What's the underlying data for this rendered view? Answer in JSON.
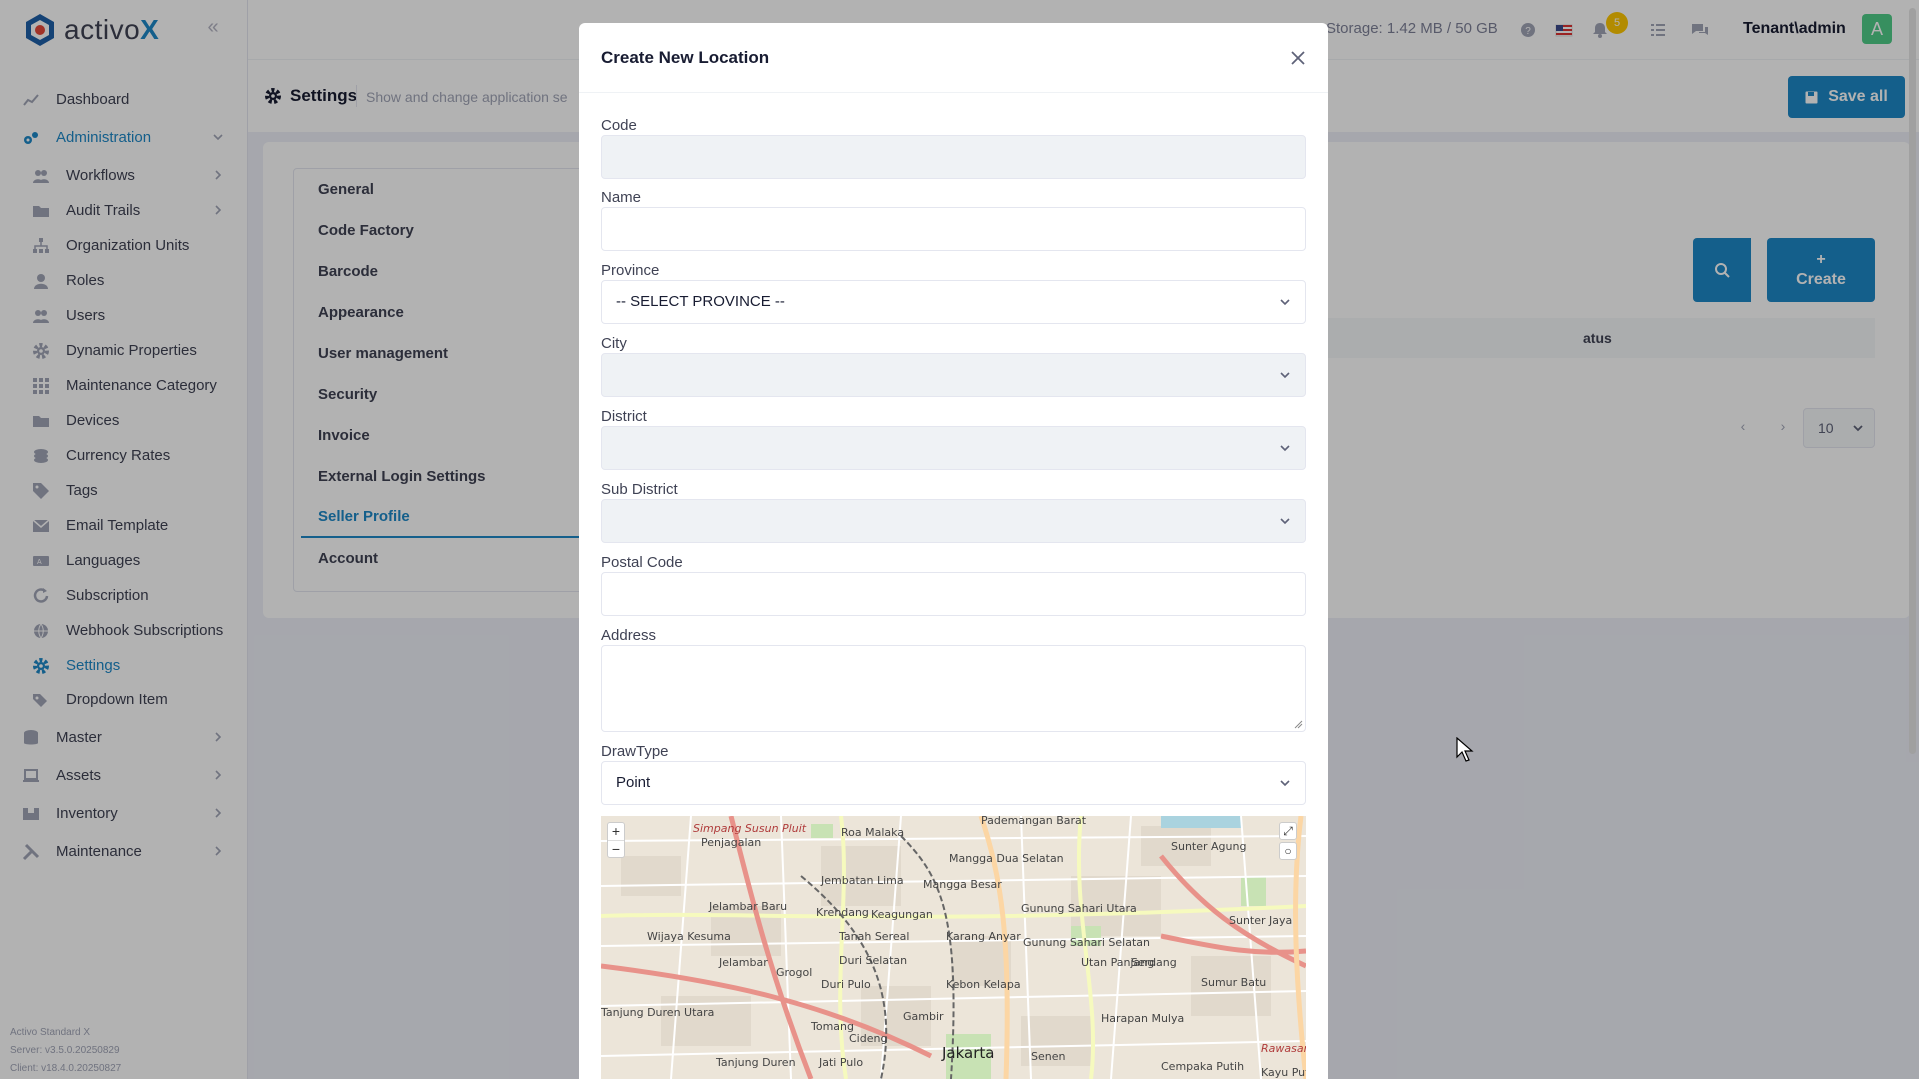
{
  "app": {
    "logo_prefix": "activo",
    "logo_suffix": "X",
    "footer": [
      "Activo Standard X",
      "Server: v3.5.0.20250829",
      "Client: v18.4.0.20250827"
    ]
  },
  "topbar": {
    "storage": "Storage: 1.42 MB / 50 GB",
    "notification_count": "5",
    "user": "Tenant\\admin",
    "avatar_initial": "A"
  },
  "sidebar": {
    "items": [
      {
        "label": "Dashboard",
        "icon": "chart-line-icon"
      },
      {
        "label": "Administration",
        "icon": "cogs-icon",
        "expanded": true
      },
      {
        "label": "Workflows",
        "icon": "users-icon"
      },
      {
        "label": "Audit Trails",
        "icon": "folder-icon"
      },
      {
        "label": "Organization Units",
        "icon": "sitemap-icon"
      },
      {
        "label": "Roles",
        "icon": "user-icon"
      },
      {
        "label": "Users",
        "icon": "users-icon"
      },
      {
        "label": "Dynamic Properties",
        "icon": "cog-icon"
      },
      {
        "label": "Maintenance Category",
        "icon": "grid-icon"
      },
      {
        "label": "Devices",
        "icon": "folder-icon"
      },
      {
        "label": "Currency Rates",
        "icon": "coins-icon"
      },
      {
        "label": "Tags",
        "icon": "tag-icon"
      },
      {
        "label": "Email Template",
        "icon": "envelope-icon"
      },
      {
        "label": "Languages",
        "icon": "language-icon"
      },
      {
        "label": "Subscription",
        "icon": "refresh-icon"
      },
      {
        "label": "Webhook Subscriptions",
        "icon": "globe-icon"
      },
      {
        "label": "Settings",
        "icon": "cog-icon",
        "active": true
      },
      {
        "label": "Dropdown Item",
        "icon": "tags-icon"
      },
      {
        "label": "Master",
        "icon": "database-icon"
      },
      {
        "label": "Assets",
        "icon": "laptop-icon"
      },
      {
        "label": "Inventory",
        "icon": "box-icon"
      },
      {
        "label": "Maintenance",
        "icon": "tools-icon"
      }
    ]
  },
  "subheader": {
    "title": "Settings",
    "description": "Show and change application se",
    "save_all": "Save all"
  },
  "settings_tabs": [
    "General",
    "Code Factory",
    "Barcode",
    "Appearance",
    "User management",
    "Security",
    "Invoice",
    "External Login Settings",
    "Seller Profile",
    "Account"
  ],
  "active_tab": "Seller Profile",
  "locations_panel": {
    "create_label": "Create",
    "status_header": "atus",
    "page_size": "10"
  },
  "modal": {
    "title": "Create New Location",
    "fields": {
      "code": {
        "label": "Code",
        "value": ""
      },
      "name": {
        "label": "Name",
        "value": ""
      },
      "province": {
        "label": "Province",
        "value": "-- SELECT PROVINCE --"
      },
      "city": {
        "label": "City",
        "value": ""
      },
      "district": {
        "label": "District",
        "value": ""
      },
      "sub_district": {
        "label": "Sub District",
        "value": ""
      },
      "postal_code": {
        "label": "Postal Code",
        "value": ""
      },
      "address": {
        "label": "Address",
        "value": ""
      },
      "draw_type": {
        "label": "DrawType",
        "value": "Point"
      }
    }
  },
  "map": {
    "labels": [
      "Pademangan Barat",
      "Simpang Susun Pluit",
      "Penjagalan",
      "Roa Malaka",
      "Sunter Agung",
      "Jembatan Lima",
      "Mangga Besar",
      "Mangga Dua Selatan",
      "Jelambar Baru",
      "Krendang",
      "Keagungan",
      "Gunung Sahari Utara",
      "Sunter Jaya",
      "Wijaya Kesuma",
      "Tanah Sereal",
      "Karang Anyar",
      "Gunung Sahari Selatan",
      "Jelambar",
      "Duri Selatan",
      "Grogol",
      "Duri Pulo",
      "Kebon Kelapa",
      "Utan Panjang",
      "Serdang",
      "Sumur Batu",
      "Tanjung Duren Utara",
      "Tomang",
      "Gambir",
      "Cideng",
      "Harapan Mulya",
      "Jakarta",
      "Senen",
      "Kayu Putih",
      "Cempaka Putih",
      "Jati Pulo",
      "Tanjung Duren",
      "Rawasari"
    ],
    "zoom_in": "+",
    "zoom_out": "−"
  },
  "colors": {
    "primary": "#1e88c7",
    "success": "#50cd89",
    "warning": "#ffc700"
  }
}
